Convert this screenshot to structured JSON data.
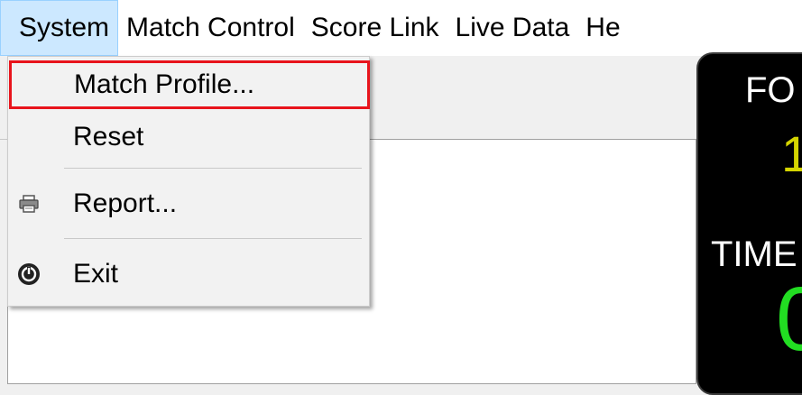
{
  "menubar": {
    "items": [
      {
        "label": "System",
        "active": true
      },
      {
        "label": "Match Control"
      },
      {
        "label": "Score Link"
      },
      {
        "label": "Live Data"
      },
      {
        "label": "He"
      }
    ]
  },
  "system_menu": {
    "items": [
      {
        "label": "Match Profile...",
        "icon": null,
        "highlighted": true
      },
      {
        "label": "Reset",
        "icon": null
      },
      {
        "label": "Report...",
        "icon": "printer-icon"
      },
      {
        "label": "Exit",
        "icon": "power-icon"
      }
    ]
  },
  "scoreboard": {
    "fouls_label": "FO",
    "fouls_value": "1",
    "time_label": "TIME",
    "time_value": "0"
  },
  "colors": {
    "highlight_border": "#e8141c",
    "active_menu_bg": "#cce8ff",
    "time_digit": "#22dd22",
    "fouls_digit": "#d4d400"
  }
}
